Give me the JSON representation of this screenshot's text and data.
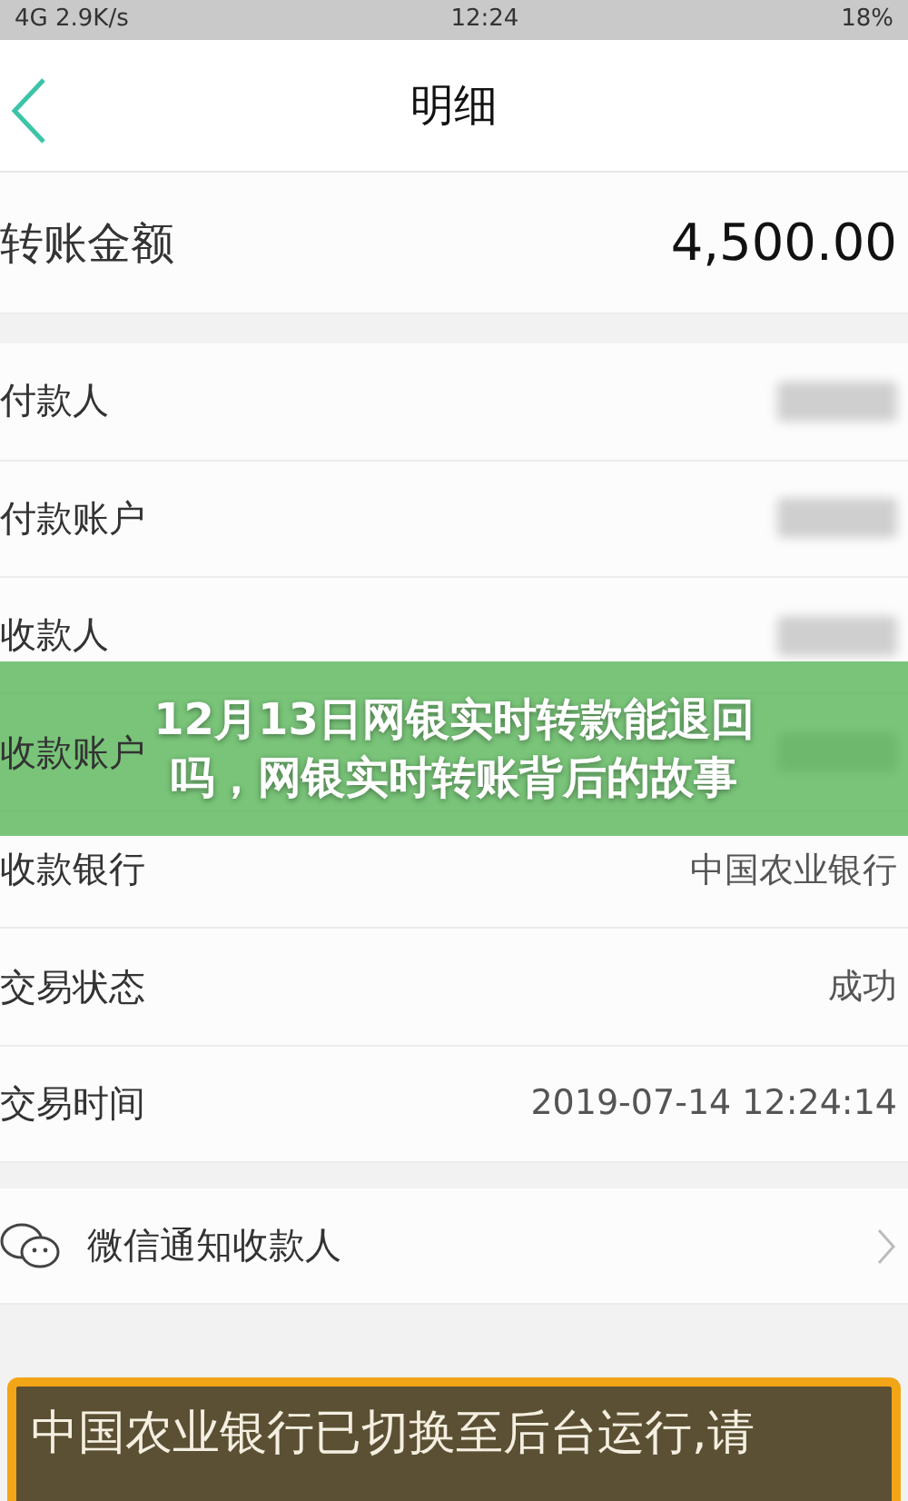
{
  "status_bar": {
    "network": "4G",
    "speed": "2.9K/s",
    "time": "12:24",
    "battery": "18%"
  },
  "nav": {
    "title": "明细"
  },
  "amount": {
    "label": "转账金额",
    "value": "4,500.00"
  },
  "details": [
    {
      "label": "付款人",
      "kind": "blurred"
    },
    {
      "label": "付款账户",
      "kind": "blurred"
    },
    {
      "label": "收款人",
      "kind": "blurred"
    },
    {
      "label": "收款账户",
      "kind": "blurred"
    },
    {
      "label": "收款银行",
      "kind": "text",
      "value": "中国农业银行"
    },
    {
      "label": "交易状态",
      "kind": "text",
      "value": "成功"
    },
    {
      "label": "交易时间",
      "kind": "text",
      "value": "2019-07-14 12:24:14"
    }
  ],
  "notify": {
    "label": "微信通知收款人"
  },
  "banner": {
    "title": "12月13日网银实时转款能退回吗，网银实时转账背后的故事"
  },
  "toast": {
    "text": "中国农业银行已切换至后台运行,请"
  }
}
